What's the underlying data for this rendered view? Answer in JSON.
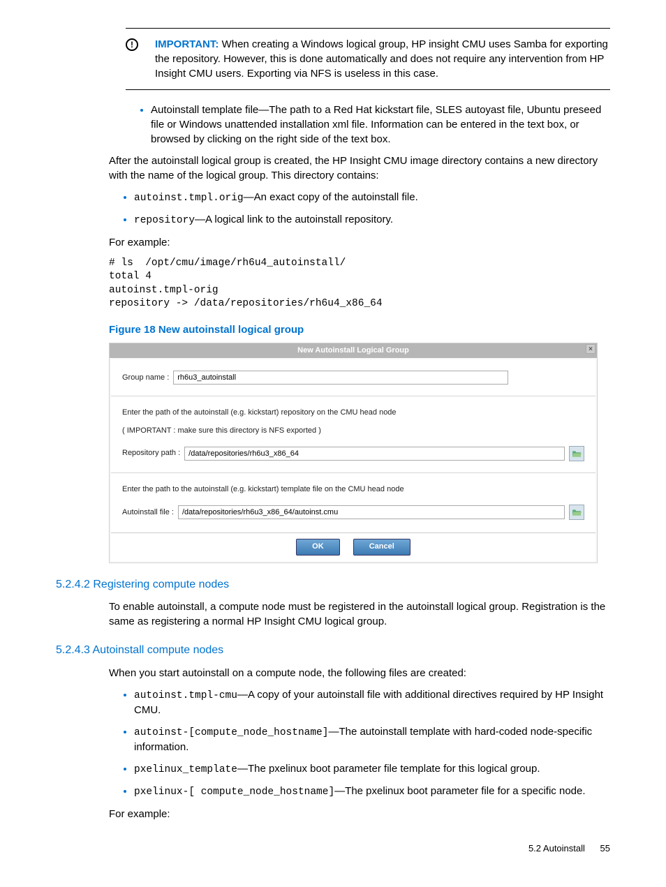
{
  "important": {
    "label": "IMPORTANT:",
    "text": "When creating a Windows logical group, HP insight CMU uses Samba for exporting the repository. However, this is done automatically and does not require any intervention from HP Insight CMU users. Exporting via NFS is useless in this case."
  },
  "bullet_template": {
    "text": "Autoinstall template file—The path to a Red Hat kickstart file, SLES autoyast file, Ubuntu preseed file or Windows unattended installation xml file. Information can be entered in the text box, or browsed by clicking on the right side of the text box."
  },
  "para_after_group": "After the autoinstall logical group is created, the HP Insight CMU image directory contains a new directory with the name of the logical group. This directory contains:",
  "dir_bullets": {
    "b1_code": "autoinst.tmpl.orig",
    "b1_text": "—An exact copy of the autoinstall file.",
    "b2_code": "repository",
    "b2_text": "—A logical link to the autoinstall repository."
  },
  "for_example": "For example:",
  "codeblock1": "# ls  /opt/cmu/image/rh6u4_autoinstall/\ntotal 4\nautoinst.tmpl-orig\nrepository -> /data/repositories/rh6u4_x86_64",
  "figure_caption": "Figure 18 New autoinstall logical group",
  "dialog": {
    "title": "New Autoinstall Logical Group",
    "group_label": "Group name :",
    "group_value": "rh6u3_autoinstall",
    "repo_hint1": "Enter the path of the autoinstall (e.g. kickstart) repository on the CMU head node",
    "repo_hint2": "( IMPORTANT : make sure this directory is NFS exported )",
    "repo_label": "Repository path :",
    "repo_value": "/data/repositories/rh6u3_x86_64",
    "file_hint": "Enter the path to the autoinstall (e.g. kickstart) template file on the CMU head node",
    "file_label": "Autoinstall file :",
    "file_value": "/data/repositories/rh6u3_x86_64/autoinst.cmu",
    "ok": "OK",
    "cancel": "Cancel"
  },
  "sec_5242": {
    "heading": "5.2.4.2 Registering compute nodes",
    "para": "To enable autoinstall, a compute node must be registered in the autoinstall logical group. Registration is the same as registering a normal HP Insight CMU logical group."
  },
  "sec_5243": {
    "heading": "5.2.4.3 Autoinstall compute nodes",
    "para": "When you start autoinstall on a compute node, the following files are created:",
    "items": {
      "i1_code": "autoinst.tmpl-cmu",
      "i1_text": "—A copy of your autoinstall file with additional directives required by HP Insight CMU.",
      "i2_code": "autoinst-[compute_node_hostname]",
      "i2_text": "—The autoinstall template with hard-coded node-specific information.",
      "i3_code": "pxelinux_template",
      "i3_text": "—The pxelinux boot parameter file template for this logical group.",
      "i4_code": "pxelinux-[ compute_node_hostname]",
      "i4_text": "—The pxelinux boot parameter file for a specific node."
    }
  },
  "footer": {
    "section": "5.2 Autoinstall",
    "page": "55"
  }
}
